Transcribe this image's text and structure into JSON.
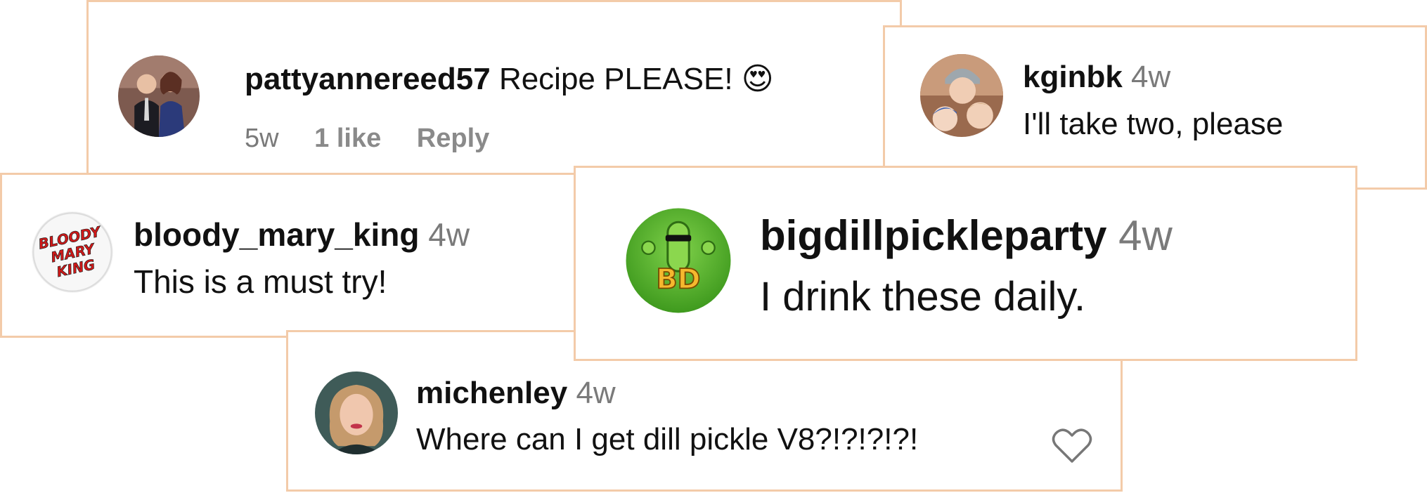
{
  "comments": [
    {
      "username": "pattyannereed57",
      "text": "Recipe PLEASE!",
      "emoji": "😍",
      "time": "5w",
      "likes": "1 like",
      "reply": "Reply"
    },
    {
      "username": "kginbk",
      "time": "4w",
      "text": "I'll take two, please"
    },
    {
      "username": "bloody_mary_king",
      "time": "4w",
      "text": "This is a must try!",
      "avatar_logo": "BLOODY MARY KING"
    },
    {
      "username": "bigdillpickleparty",
      "time": "4w",
      "text": "I drink these daily.",
      "avatar_logo": "BD"
    },
    {
      "username": "michenley",
      "time": "4w",
      "text": "Where can I get dill pickle V8?!?!?!?!",
      "like_icon": "heart-outline-icon"
    }
  ],
  "colors": {
    "card_border": "#f3cba9",
    "muted_text": "#7a7a7a"
  }
}
